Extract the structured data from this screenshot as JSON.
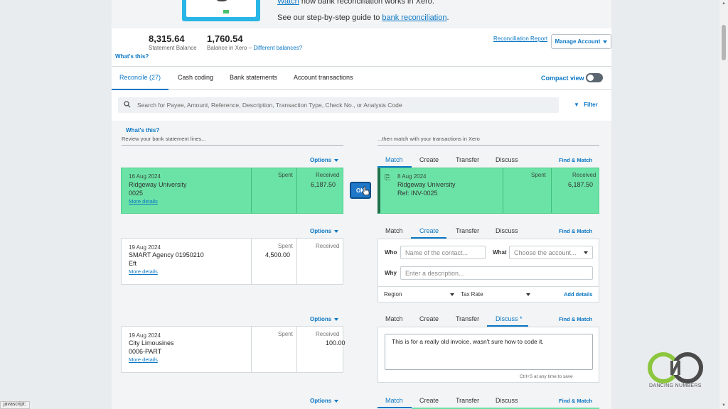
{
  "banner": {
    "line1_link": "Watch",
    "line1_rest": "how bank reconciliation works in Xero.",
    "line2_pre": "See our step-by-step guide to",
    "line2_link": "bank reconciliation",
    "line2_post": "."
  },
  "summary": {
    "statement_balance": "8,315.64",
    "statement_balance_label": "Statement Balance",
    "xero_balance": "1,760.54",
    "xero_balance_label": "Balance in Xero",
    "dash": "–",
    "different_balances": "Different balances?",
    "whats_this": "What's this?",
    "reconciliation_report": "Reconciliation Report",
    "manage_account": "Manage Account"
  },
  "tabs": [
    "Reconcile (27)",
    "Cash coding",
    "Bank statements",
    "Account transactions"
  ],
  "compact_view": "Compact view",
  "search": {
    "placeholder": "Search for Payee, Amount, Reference, Description, Transaction Type, Check No., or Analysis Code",
    "filter": "Filter"
  },
  "left_header": {
    "whats_this": "What's this?",
    "review": "Review your bank statement lines..."
  },
  "right_header": "...then match with your transactions in Xero",
  "options": "Options",
  "spent_label": "Spent",
  "received_label": "Received",
  "more_details": "More details",
  "action_tabs": [
    "Match",
    "Create",
    "Transfer",
    "Discuss"
  ],
  "discuss_star": "Discuss *",
  "find_match": "Find & Match",
  "ok": "OK",
  "rows": [
    {
      "date": "16 Aug 2024",
      "payee": "Ridgeway University",
      "ref": "0025",
      "spent": "",
      "received": "6,187.50"
    },
    {
      "date": "19 Aug 2024",
      "payee": "SMART Agency 01950210",
      "ref": "Eft",
      "spent": "4,500.00",
      "received": ""
    },
    {
      "date": "19 Aug 2024",
      "payee": "City Limousines",
      "ref": "0006-PART",
      "spent": "",
      "received": "100.00"
    }
  ],
  "match1": {
    "date": "8 Aug 2024",
    "payee": "Ridgeway University",
    "ref": "Ref: INV-0025",
    "spent": "",
    "received": "6,187.50"
  },
  "create": {
    "who": "Who",
    "who_placeholder": "Name of the contact...",
    "what": "What",
    "what_placeholder": "Choose the account...",
    "why": "Why",
    "why_placeholder": "Enter a description...",
    "region": "Region",
    "tax_rate": "Tax Rate",
    "add_details": "Add details"
  },
  "discuss": {
    "text": "This is for a really old invoice, wasn't sure how to code it.",
    "hint": "Ctrl+S at any time to save"
  },
  "logo": {
    "text": "DANCING NUMBERS"
  },
  "status_bar": "javascript:",
  "colors": {
    "accent": "#0b77c5",
    "match_green": "#6be3a6"
  }
}
